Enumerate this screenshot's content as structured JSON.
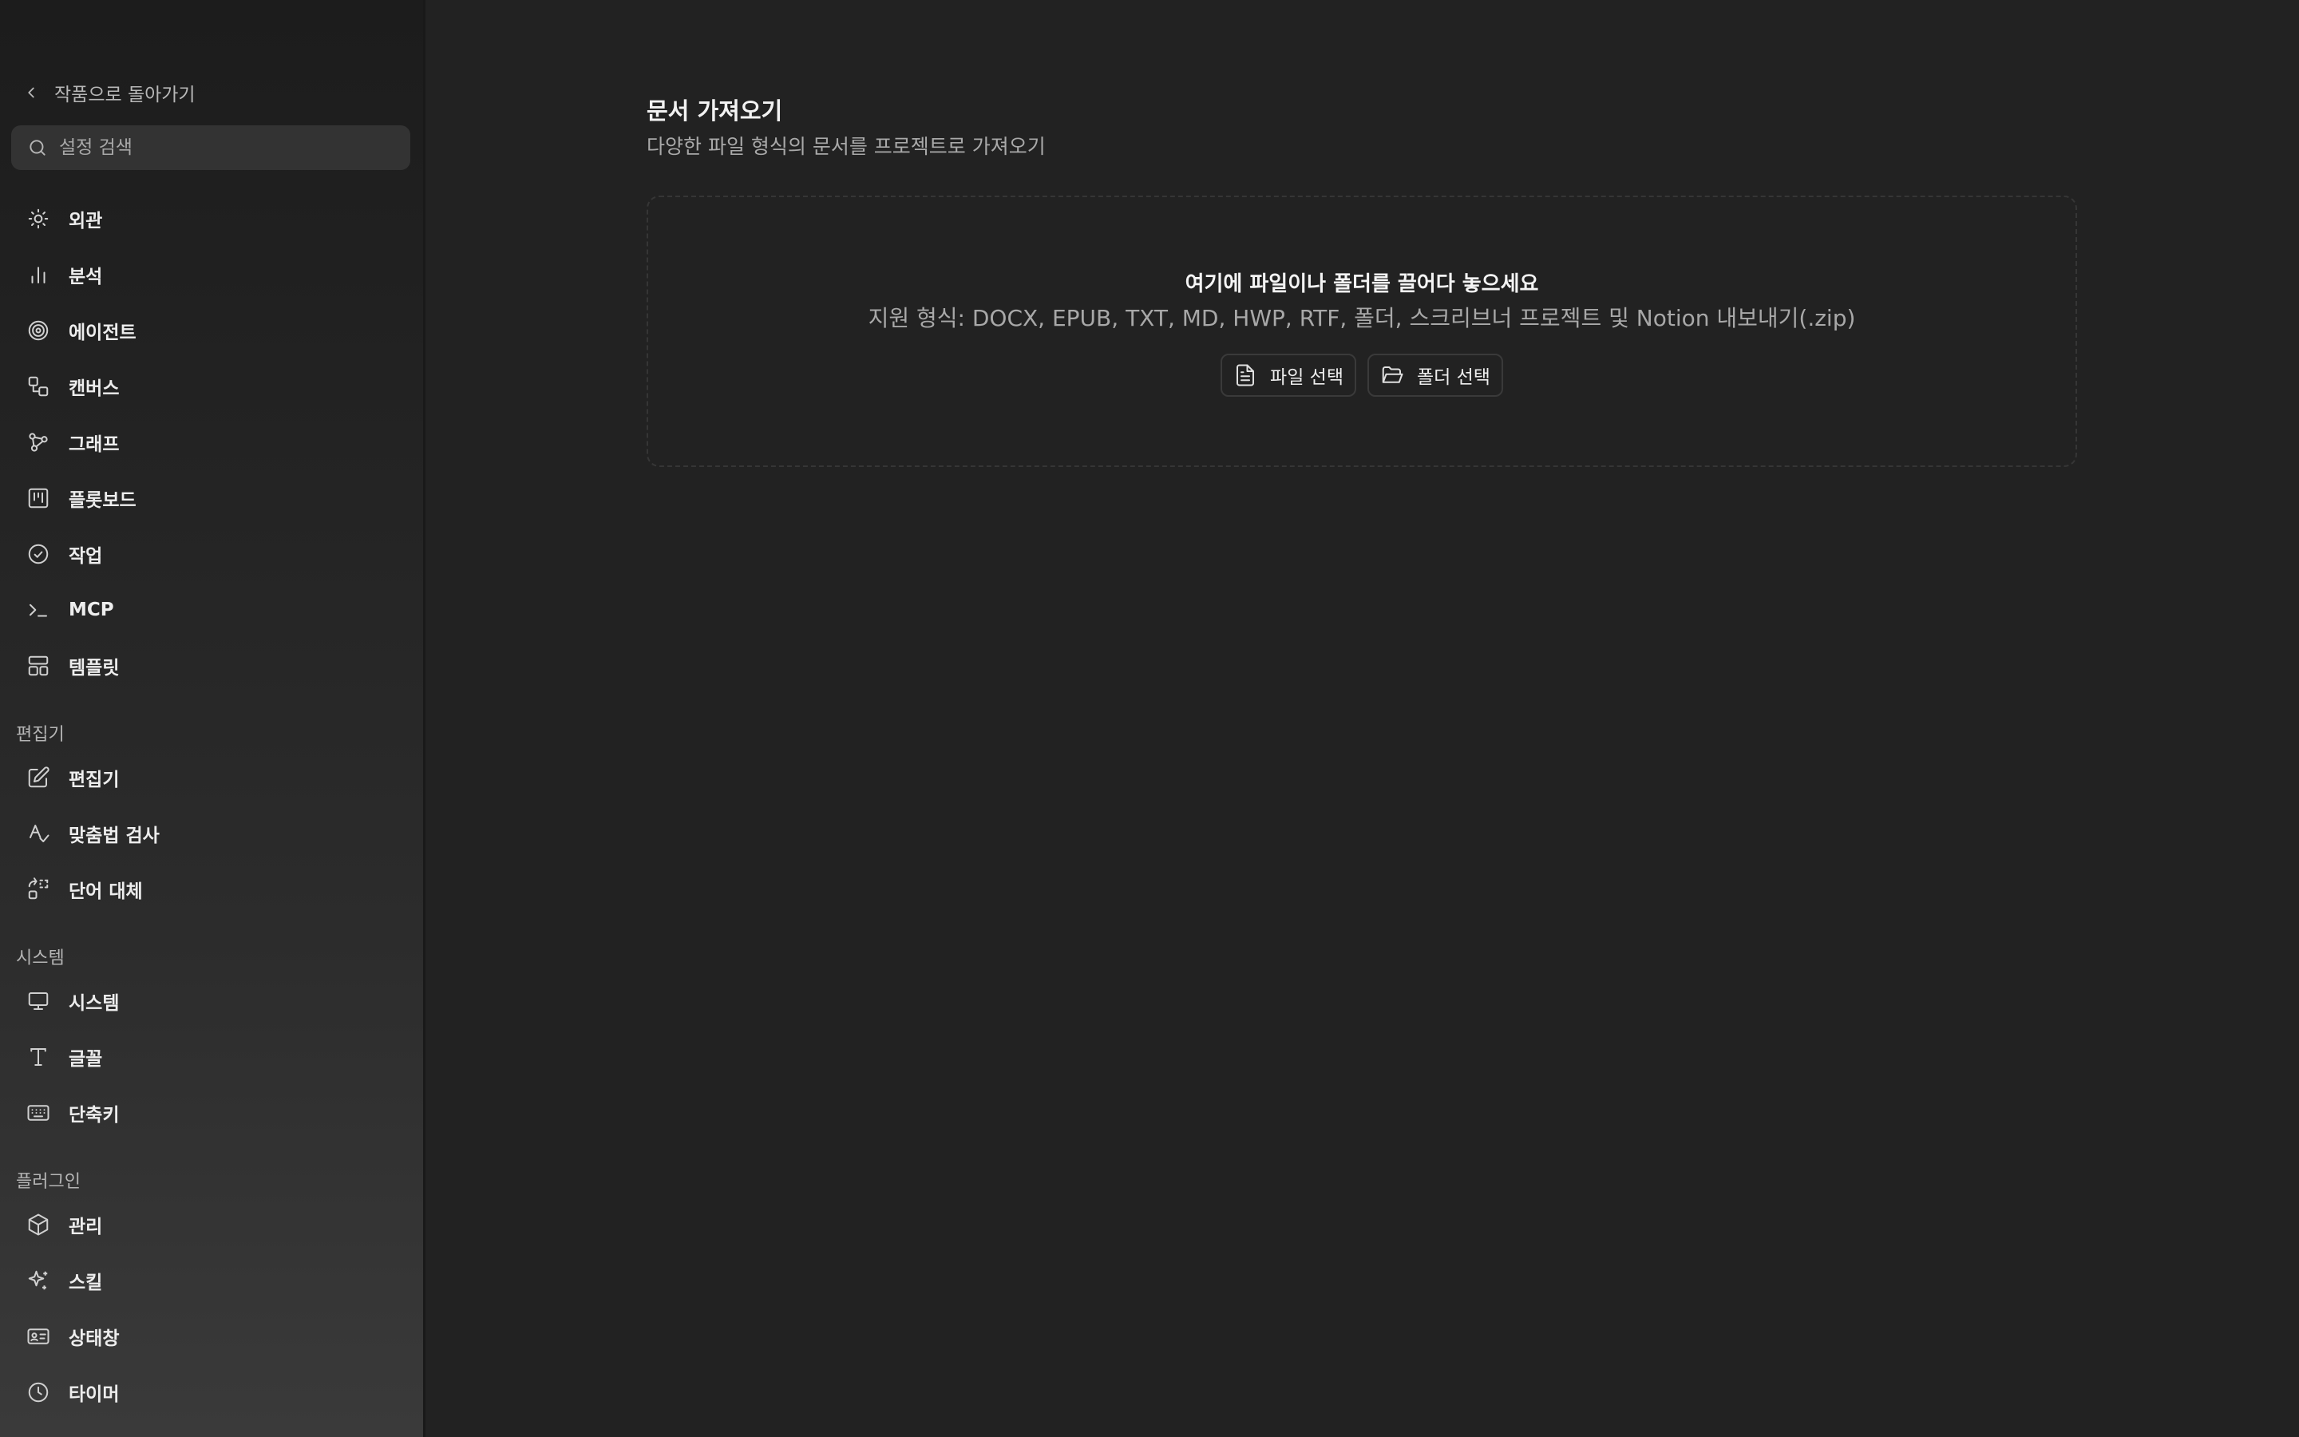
{
  "sidebar": {
    "back_label": "작품으로 돌아가기",
    "search_placeholder": "설정 검색",
    "items": [
      {
        "label": "외관",
        "icon": "sun-icon"
      },
      {
        "label": "분석",
        "icon": "bar-chart-icon"
      },
      {
        "label": "에이전트",
        "icon": "spiral-icon"
      },
      {
        "label": "캔버스",
        "icon": "shapes-icon"
      },
      {
        "label": "그래프",
        "icon": "graph-nodes-icon"
      },
      {
        "label": "플롯보드",
        "icon": "kanban-icon"
      },
      {
        "label": "작업",
        "icon": "check-circle-icon"
      },
      {
        "label": "MCP",
        "icon": "terminal-icon"
      },
      {
        "label": "템플릿",
        "icon": "layout-template-icon"
      }
    ],
    "sections": [
      {
        "title": "편집기",
        "items": [
          {
            "label": "편집기",
            "icon": "edit-icon"
          },
          {
            "label": "맞춤법 검사",
            "icon": "spell-check-icon"
          },
          {
            "label": "단어 대체",
            "icon": "replace-icon"
          }
        ]
      },
      {
        "title": "시스템",
        "items": [
          {
            "label": "시스템",
            "icon": "monitor-icon"
          },
          {
            "label": "글꼴",
            "icon": "type-icon"
          },
          {
            "label": "단축키",
            "icon": "keyboard-icon"
          }
        ]
      },
      {
        "title": "플러그인",
        "items": [
          {
            "label": "관리",
            "icon": "package-icon"
          },
          {
            "label": "스킬",
            "icon": "sparkles-icon"
          },
          {
            "label": "상태창",
            "icon": "id-card-icon"
          },
          {
            "label": "타이머",
            "icon": "clock-icon"
          }
        ]
      }
    ]
  },
  "main": {
    "title": "문서 가져오기",
    "subtitle": "다양한 파일 형식의 문서를 프로젝트로 가져오기",
    "dropzone": {
      "title": "여기에 파일이나 폴더를 끌어다 놓으세요",
      "formats": "지원 형식: DOCX, EPUB, TXT, MD, HWP, RTF, 폴더, 스크리브너 프로젝트 및 Notion 내보내기(.zip)",
      "file_button": "파일 선택",
      "folder_button": "폴더 선택"
    }
  },
  "colors": {
    "background": "#222222",
    "sidebar_top": "#1c1c1c",
    "sidebar_bottom": "#3a3a3a",
    "text_primary": "#ededed",
    "text_secondary": "#a8a8a8"
  }
}
